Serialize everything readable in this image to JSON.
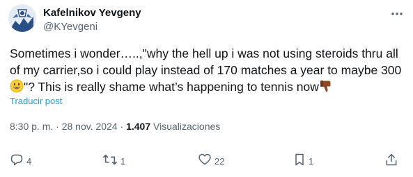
{
  "author": {
    "name": "Kafelnikov Yevgeny",
    "handle": "@KYevgeni"
  },
  "tweet": {
    "line1": "Sometimes i wonder…..,\"why the hell up i was not using steroids thru all",
    "line2": "of my carrier,so i could play instead of 170 matches a year to maybe 300",
    "line3_after_emoji": "\"? This is really shame what’s happening to tennis now",
    "emoji_1": "grinning-face",
    "emoji_2": "thumbs-down"
  },
  "translate_label": "Traducir post",
  "meta": {
    "time": "8:30 p. m.",
    "separator": "·",
    "date": "28 nov. 2024",
    "views_count": "1.407",
    "views_label": "Visualizaciones"
  },
  "actions": {
    "replies": "4",
    "reposts": "1",
    "likes": "22",
    "bookmarks": "1"
  },
  "colors": {
    "text": "#0f1419",
    "secondary": "#536471",
    "link": "#1d9bf0"
  }
}
